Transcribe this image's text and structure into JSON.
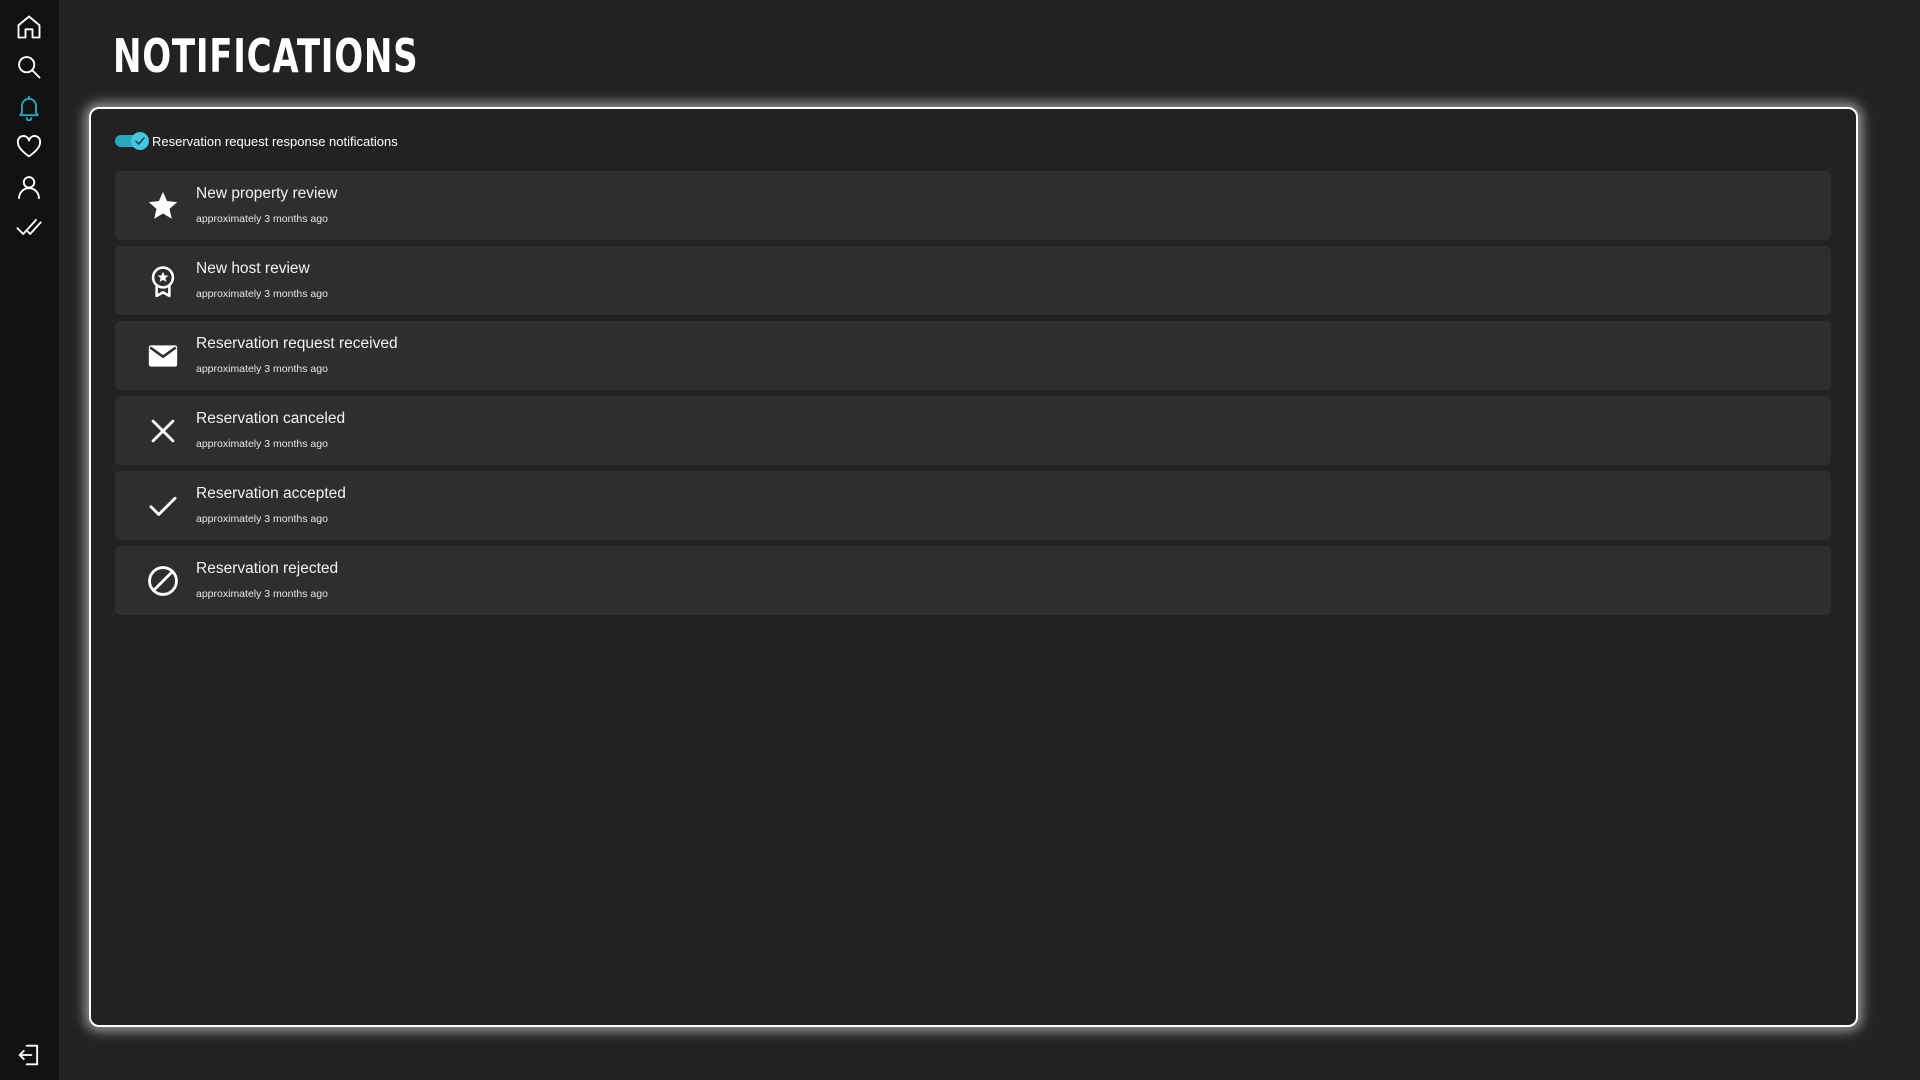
{
  "sidebar": {
    "items": [
      {
        "icon": "home-icon",
        "active": false
      },
      {
        "icon": "search-icon",
        "active": false
      },
      {
        "icon": "bell-icon",
        "active": true
      },
      {
        "icon": "heart-icon",
        "active": false
      },
      {
        "icon": "user-icon",
        "active": false
      },
      {
        "icon": "double-check-icon",
        "active": false
      }
    ],
    "logout_icon": "logout-icon"
  },
  "page": {
    "title": "NOTIFICATIONS"
  },
  "settings": {
    "toggle_label": "Reservation request response notifications",
    "toggle_on": true
  },
  "notifications": [
    {
      "icon": "star-icon",
      "title": "New property review",
      "time": "approximately 3 months ago"
    },
    {
      "icon": "badge-icon",
      "title": "New host review",
      "time": "approximately 3 months ago"
    },
    {
      "icon": "mail-icon",
      "title": "Reservation request received",
      "time": "approximately 3 months ago"
    },
    {
      "icon": "close-icon",
      "title": "Reservation canceled",
      "time": "approximately 3 months ago"
    },
    {
      "icon": "check-icon",
      "title": "Reservation accepted",
      "time": "approximately 3 months ago"
    },
    {
      "icon": "block-icon",
      "title": "Reservation rejected",
      "time": "approximately 3 months ago"
    }
  ],
  "colors": {
    "background": "#222222",
    "sidebar": "#111111",
    "accent": "#2aa8c4",
    "card": "#2e2e2e",
    "text": "#ffffff"
  }
}
